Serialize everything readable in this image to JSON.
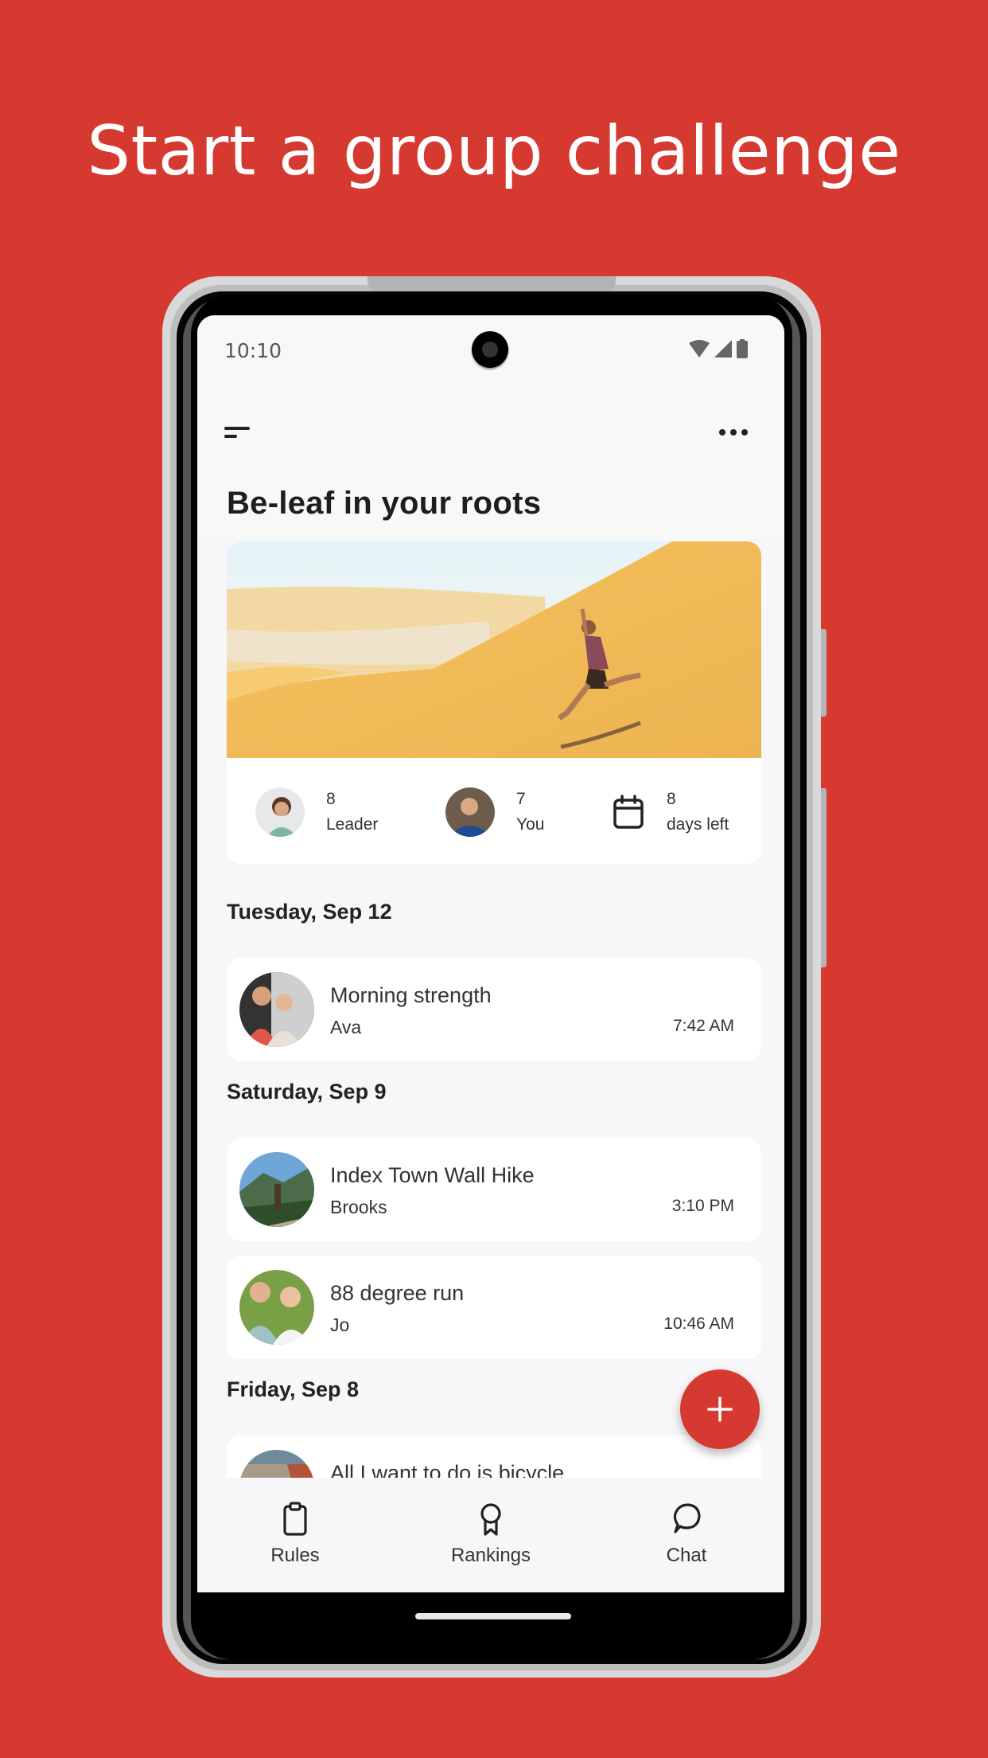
{
  "headline": "Start a group challenge",
  "colors": {
    "brand": "#D5392F",
    "screen_bg": "#F7F7F9",
    "card_bg": "#FFFFFF",
    "text": "#333333"
  },
  "status_bar": {
    "time": "10:10",
    "icons": [
      "wifi-icon",
      "signal-icon",
      "battery-icon"
    ]
  },
  "app_bar": {
    "menu_icon": "menu-icon",
    "more_icon": "more-horizontal-icon"
  },
  "challenge": {
    "title": "Be-leaf in your roots",
    "hero_image": "person jumping on sand dune",
    "stats": [
      {
        "value": "8",
        "label": "Leader",
        "icon": "leader-avatar"
      },
      {
        "value": "7",
        "label": "You",
        "icon": "user-avatar"
      },
      {
        "value": "8",
        "label": "days left",
        "icon": "calendar-icon"
      }
    ]
  },
  "feed": [
    {
      "date": "Tuesday, Sep 12",
      "activities": [
        {
          "title": "Morning strength",
          "user": "Ava",
          "time": "7:42 AM"
        }
      ]
    },
    {
      "date": "Saturday, Sep 9",
      "activities": [
        {
          "title": "Index Town Wall Hike",
          "user": "Brooks",
          "time": "3:10 PM"
        },
        {
          "title": "88 degree run",
          "user": "Jo",
          "time": "10:46 AM"
        }
      ]
    },
    {
      "date": "Friday, Sep 8",
      "activities": [
        {
          "title": "All I want to do is bicycle",
          "user": "",
          "time": ""
        }
      ]
    }
  ],
  "fab": {
    "icon": "plus-icon",
    "label": "Add activity"
  },
  "bottom_nav": [
    {
      "label": "Rules",
      "icon": "clipboard-icon"
    },
    {
      "label": "Rankings",
      "icon": "award-icon"
    },
    {
      "label": "Chat",
      "icon": "chat-bubble-icon"
    }
  ]
}
